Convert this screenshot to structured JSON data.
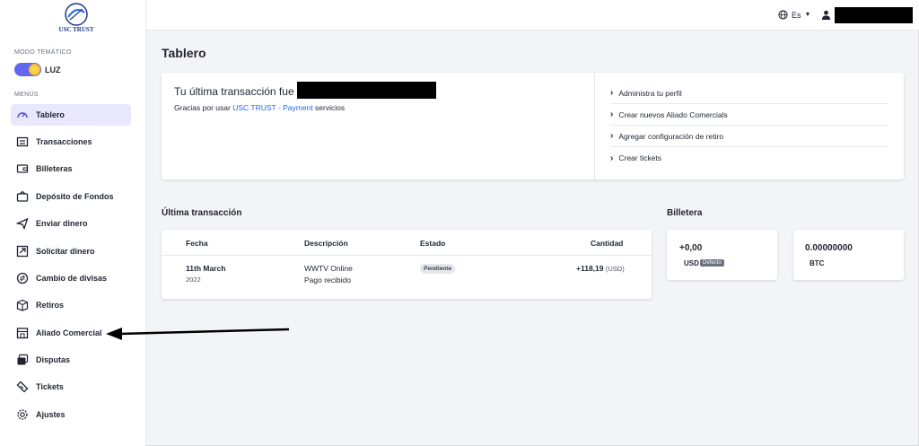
{
  "logo": {
    "text": "USC TRUST"
  },
  "sidebar": {
    "theme_label": "MODO TEMÁTICO",
    "theme_toggle_label": "LUZ",
    "menus_label": "MENÚS",
    "items": [
      {
        "label": "Tablero",
        "icon": "speedometer-icon",
        "active": true
      },
      {
        "label": "Transacciones",
        "icon": "transactions-icon"
      },
      {
        "label": "Billeteras",
        "icon": "wallet-icon"
      },
      {
        "label": "Depósito de Fondos",
        "icon": "deposit-icon"
      },
      {
        "label": "Enviar dinero",
        "icon": "send-icon"
      },
      {
        "label": "Solicitar dinero",
        "icon": "request-money-icon"
      },
      {
        "label": "Cambio de divisas",
        "icon": "exchange-icon"
      },
      {
        "label": "Retiros",
        "icon": "withdraw-box-icon"
      },
      {
        "label": "Aliado Comercial",
        "icon": "store-icon"
      },
      {
        "label": "Disputas",
        "icon": "dispute-icon"
      },
      {
        "label": "Tickets",
        "icon": "ticket-icon"
      },
      {
        "label": "Ajustes",
        "icon": "gear-icon"
      }
    ]
  },
  "topbar": {
    "language": "Es"
  },
  "page": {
    "title": "Tablero"
  },
  "welcome": {
    "title": "Tu última transacción fue",
    "sub_prefix": "Gracias por usar",
    "sub_link": "USC TRUST - Payment",
    "sub_suffix": "servicios"
  },
  "quick_links": [
    "Administra tu perfil",
    "Crear nuevos Aliado Comercials",
    "Agregar configuración de retiro",
    "Crear tickets"
  ],
  "last_transaction": {
    "title": "Última transacción",
    "headers": [
      "Fecha",
      "Descripción",
      "Estado",
      "Cantidad"
    ],
    "row": {
      "date": "11th March",
      "year": "2022",
      "desc1": "WWTV Online",
      "desc2": "Pago recibido",
      "status": "Pendiente",
      "amount": "+118,19",
      "currency": "(USD)"
    }
  },
  "wallet": {
    "title": "Billetera",
    "items": [
      {
        "value": "+0,00",
        "currency": "USD",
        "badge": "Defecto"
      },
      {
        "value": "0.00000000",
        "currency": "BTC"
      }
    ]
  },
  "colors": {
    "accent": "#6366f1",
    "link": "#2563eb",
    "active_bg": "#e8e7fb"
  }
}
